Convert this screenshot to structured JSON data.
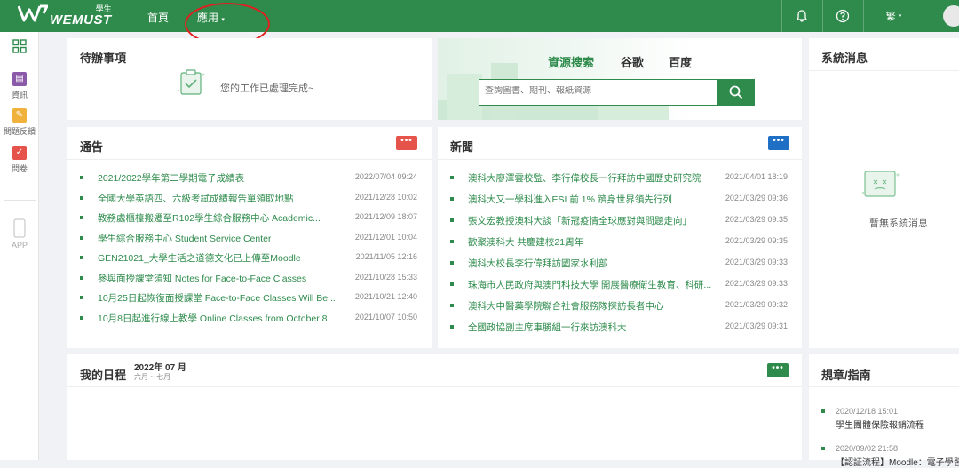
{
  "header": {
    "logo_cn": "學生",
    "logo_text": "WEMUST",
    "nav": [
      {
        "label": "首頁"
      },
      {
        "label": "應用"
      }
    ],
    "nav_dropdown_icon": "chevron-down-icon",
    "lang": "繁"
  },
  "sidebar": {
    "items": [
      {
        "label": "資訊",
        "color": "#8a5aa8"
      },
      {
        "label": "問題反饋",
        "color": "#f0b23c"
      },
      {
        "label": "問卷",
        "color": "#e5534b"
      },
      {
        "label": "APP",
        "color": "#cccccc"
      }
    ]
  },
  "todo": {
    "title": "待辦事項",
    "message": "您的工作已處理完成~"
  },
  "search": {
    "tabs": [
      "資源搜索",
      "谷歌",
      "百度"
    ],
    "placeholder": "查詢圖書、期刊、報紙資源"
  },
  "notices": {
    "title": "通告",
    "more": "•••",
    "items": [
      {
        "text": "2021/2022學年第二學期電子成績表",
        "date": "2022/07/04 09:24"
      },
      {
        "text": "全國大學英語四、六級考試成績報告單領取地點",
        "date": "2021/12/28 10:02"
      },
      {
        "text": "教務處櫃檯搬遷至R102學生綜合服務中心 Academic...",
        "date": "2021/12/09 18:07"
      },
      {
        "text": "學生綜合服務中心 Student Service Center",
        "date": "2021/12/01 10:04"
      },
      {
        "text": "GEN21021_大學生活之道德文化已上傳至Moodle",
        "date": "2021/11/05 12:16"
      },
      {
        "text": "參與面授課堂須知 Notes for Face-to-Face Classes",
        "date": "2021/10/28 15:33"
      },
      {
        "text": "10月25日起恢復面授課堂 Face-to-Face Classes Will Be...",
        "date": "2021/10/21 12:40"
      },
      {
        "text": "10月8日起進行線上教學 Online Classes from October 8",
        "date": "2021/10/07 10:50"
      }
    ]
  },
  "news": {
    "title": "新聞",
    "more": "•••",
    "items": [
      {
        "text": "澳科大廖澤雲校監、李行偉校長一行拜訪中國歷史研究院",
        "date": "2021/04/01 18:19"
      },
      {
        "text": "澳科大又一學科進入ESI 前 1% 躋身世界領先行列",
        "date": "2021/03/29 09:36"
      },
      {
        "text": "張文宏教授澳科大談「新冠疫情全球應對與問題走向」",
        "date": "2021/03/29 09:35"
      },
      {
        "text": "歡聚澳科大 共慶建校21周年",
        "date": "2021/03/29 09:35"
      },
      {
        "text": "澳科大校長李行偉拜訪國家水利部",
        "date": "2021/03/29 09:33"
      },
      {
        "text": "珠海市人民政府與澳門科技大學 開展醫療衛生教育、科研...",
        "date": "2021/03/29 09:33"
      },
      {
        "text": "澳科大中醫藥學院聯合社會服務隊探訪長者中心",
        "date": "2021/03/29 09:32"
      },
      {
        "text": "全國政協副主席車勝組一行來訪澳科大",
        "date": "2021/03/29 09:31"
      }
    ]
  },
  "system": {
    "title": "系統消息",
    "empty": "暫無系統消息"
  },
  "schedule": {
    "title": "我的日程",
    "month": "2022年 07 月",
    "range": "六月 ~ 七月",
    "more": "•••"
  },
  "regulations": {
    "title": "規章/指南",
    "items": [
      {
        "date": "2020/12/18 15:01",
        "text": "學生團體保險報銷流程"
      },
      {
        "date": "2020/09/02 21:58",
        "text": "【認証流程】Moodle：電子學習..."
      }
    ]
  },
  "colors": {
    "brand": "#2e8b4c",
    "notice_more": "#e5534b",
    "news_more": "#1f6fc5",
    "schedule_more": "#2e8b4c"
  }
}
